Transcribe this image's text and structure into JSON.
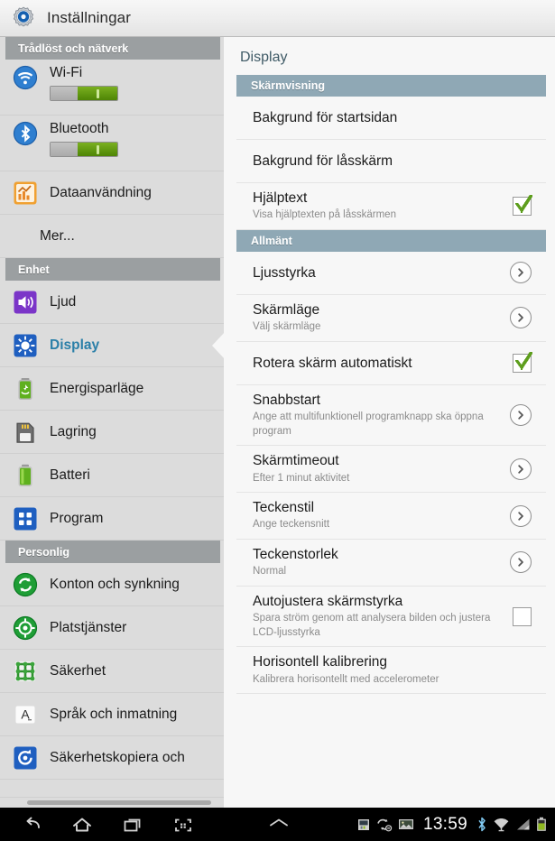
{
  "titlebar": {
    "icon": "settings-gear-icon",
    "title": "Inställningar"
  },
  "sidebar": {
    "sections": [
      {
        "header": "Trådlöst och nätverk",
        "items": [
          {
            "label": "Wi-Fi",
            "icon": "wifi-icon",
            "control": "toggle",
            "toggle_on": true
          },
          {
            "label": "Bluetooth",
            "icon": "bluetooth-icon",
            "control": "toggle",
            "toggle_on": true
          },
          {
            "label": "Dataanvändning",
            "icon": "data-usage-icon",
            "control": "none"
          },
          {
            "label": "Mer...",
            "icon": "none",
            "control": "none"
          }
        ]
      },
      {
        "header": "Enhet",
        "items": [
          {
            "label": "Ljud",
            "icon": "sound-icon",
            "control": "none"
          },
          {
            "label": "Display",
            "icon": "display-icon",
            "control": "none",
            "selected": true
          },
          {
            "label": "Energisparläge",
            "icon": "power-saving-icon",
            "control": "none"
          },
          {
            "label": "Lagring",
            "icon": "storage-icon",
            "control": "none"
          },
          {
            "label": "Batteri",
            "icon": "battery-icon",
            "control": "none"
          },
          {
            "label": "Program",
            "icon": "applications-icon",
            "control": "none"
          }
        ]
      },
      {
        "header": "Personlig",
        "items": [
          {
            "label": "Konton och synkning",
            "icon": "accounts-sync-icon",
            "control": "none"
          },
          {
            "label": "Platstjänster",
            "icon": "location-icon",
            "control": "none"
          },
          {
            "label": "Säkerhet",
            "icon": "security-icon",
            "control": "none"
          },
          {
            "label": "Språk och inmatning",
            "icon": "language-input-icon",
            "control": "none"
          },
          {
            "label": "Säkerhetskopiera och",
            "icon": "backup-reset-icon",
            "control": "none"
          }
        ]
      }
    ]
  },
  "panel": {
    "title": "Display",
    "sections": [
      {
        "header": "Skärmvisning",
        "rows": [
          {
            "title": "Bakgrund för startsidan",
            "sub": "",
            "control": "none"
          },
          {
            "title": "Bakgrund för låsskärm",
            "sub": "",
            "control": "none"
          },
          {
            "title": "Hjälptext",
            "sub": "Visa hjälptexten på låsskärmen",
            "control": "checkbox",
            "checked": true
          }
        ]
      },
      {
        "header": "Allmänt",
        "rows": [
          {
            "title": "Ljusstyrka",
            "sub": "",
            "control": "chevron"
          },
          {
            "title": "Skärmläge",
            "sub": "Välj skärmläge",
            "control": "chevron"
          },
          {
            "title": "Rotera skärm automatiskt",
            "sub": "",
            "control": "checkbox",
            "checked": true
          },
          {
            "title": "Snabbstart",
            "sub": "Ange att multifunktionell programknapp ska öppna program",
            "control": "chevron"
          },
          {
            "title": "Skärmtimeout",
            "sub": "Efter 1 minut aktivitet",
            "control": "chevron"
          },
          {
            "title": "Teckenstil",
            "sub": "Ange teckensnitt",
            "control": "chevron"
          },
          {
            "title": "Teckenstorlek",
            "sub": "Normal",
            "control": "chevron"
          },
          {
            "title": "Autojustera skärmstyrka",
            "sub": "Spara ström genom att analysera bilden och justera LCD-ljusstyrka",
            "control": "checkbox",
            "checked": false
          },
          {
            "title": "Horisontell kalibrering",
            "sub": "Kalibrera horisontellt med accelerometer",
            "control": "none"
          }
        ]
      }
    ]
  },
  "systembar": {
    "nav": [
      {
        "name": "back-icon"
      },
      {
        "name": "home-icon"
      },
      {
        "name": "recent-apps-icon"
      },
      {
        "name": "screenshot-icon"
      }
    ],
    "up_icon": "chevron-up-icon",
    "clock": "13:59",
    "status_icons_left": [
      "sd-card-icon",
      "sync-disabled-icon",
      "image-icon"
    ],
    "status_icons_right": [
      "bluetooth-status-icon",
      "wifi-status-icon",
      "signal-status-icon",
      "battery-status-icon"
    ]
  },
  "colors": {
    "sidebar_header_bg": "#9b9fa1",
    "panel_header_bg": "#8fa8b5",
    "selected_text": "#2a7fa8",
    "panel_title_text": "#3f5a66",
    "toggle_on": "#4e8505",
    "check_green": "#5e9e1e"
  }
}
